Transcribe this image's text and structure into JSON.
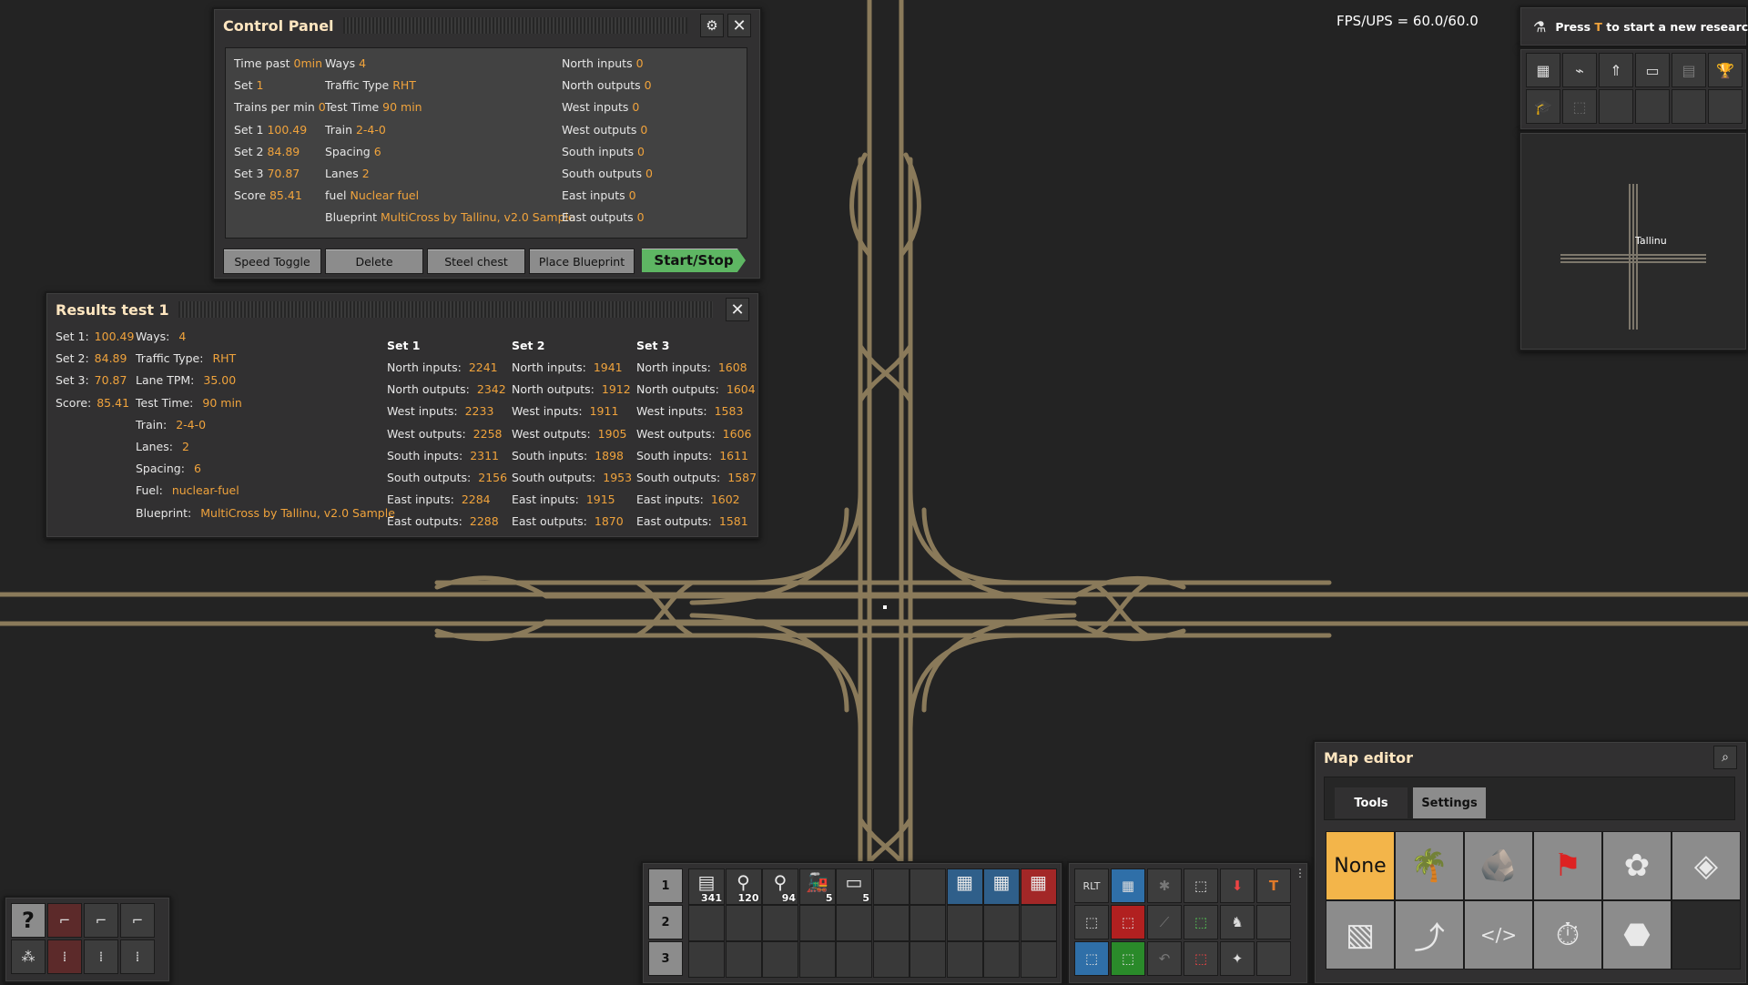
{
  "hud": {
    "fps": "FPS/UPS = 60.0/60.0"
  },
  "research": {
    "prefix": "Press ",
    "key": "T",
    "suffix": " to start a new research."
  },
  "minimap": {
    "label": "Tallinu"
  },
  "control_panel": {
    "title": "Control Panel",
    "col1": [
      {
        "label": "Time past ",
        "value": "0min"
      },
      {
        "label": "Set ",
        "value": "1"
      },
      {
        "label": "Trains per min ",
        "value": "0"
      },
      {
        "label": "Set 1 ",
        "value": "100.49"
      },
      {
        "label": "Set 2 ",
        "value": "84.89"
      },
      {
        "label": "Set 3 ",
        "value": "70.87"
      },
      {
        "label": "Score ",
        "value": "85.41"
      }
    ],
    "col2": [
      {
        "label": "Ways ",
        "value": "4"
      },
      {
        "label": "Traffic Type ",
        "value": "RHT"
      },
      {
        "label": "Test Time ",
        "value": "90 min"
      },
      {
        "label": "Train ",
        "value": "2-4-0"
      },
      {
        "label": "Spacing ",
        "value": "6"
      },
      {
        "label": "Lanes ",
        "value": "2"
      },
      {
        "label": "fuel ",
        "value": "Nuclear fuel"
      },
      {
        "label": "Blueprint ",
        "value": "MultiCross by Tallinu, v2.0 Sample"
      }
    ],
    "col3": [
      {
        "label": "North inputs ",
        "value": "0"
      },
      {
        "label": "North outputs ",
        "value": "0"
      },
      {
        "label": "West inputs ",
        "value": "0"
      },
      {
        "label": "West outputs ",
        "value": "0"
      },
      {
        "label": "South inputs ",
        "value": "0"
      },
      {
        "label": "South outputs ",
        "value": "0"
      },
      {
        "label": "East inputs ",
        "value": "0"
      },
      {
        "label": "East outputs ",
        "value": "0"
      }
    ],
    "buttons": {
      "speed_toggle": "Speed Toggle",
      "delete": "Delete",
      "steel_chest": "Steel chest",
      "place_blueprint": "Place Blueprint",
      "start_stop": "Start/Stop"
    }
  },
  "results": {
    "title": "Results test 1",
    "col1": [
      {
        "label": "Set 1:",
        "value": "100.49"
      },
      {
        "label": "Set 2:",
        "value": "84.89"
      },
      {
        "label": "Set 3:",
        "value": "70.87"
      },
      {
        "label": "Score:",
        "value": "85.41"
      }
    ],
    "col2": [
      {
        "label": "Ways:",
        "value": "4"
      },
      {
        "label": "Traffic Type:",
        "value": "RHT"
      },
      {
        "label": "Lane TPM:",
        "value": "35.00"
      },
      {
        "label": "Test Time:",
        "value": "90 min"
      },
      {
        "label": "Train:",
        "value": "2-4-0"
      },
      {
        "label": "Lanes:",
        "value": "2"
      },
      {
        "label": "Spacing:",
        "value": "6"
      },
      {
        "label": "Fuel:",
        "value": "nuclear-fuel"
      },
      {
        "label": "Blueprint:",
        "value": "MultiCross by Tallinu, v2.0 Sample"
      }
    ],
    "sets": [
      {
        "header": "Set 1",
        "rows": [
          {
            "label": "North inputs:",
            "value": "2241"
          },
          {
            "label": "North outputs:",
            "value": "2342"
          },
          {
            "label": "West inputs:",
            "value": "2233"
          },
          {
            "label": "West outputs:",
            "value": "2258"
          },
          {
            "label": "South inputs:",
            "value": "2311"
          },
          {
            "label": "South outputs:",
            "value": "2156"
          },
          {
            "label": "East inputs:",
            "value": "2284"
          },
          {
            "label": "East outputs:",
            "value": "2288"
          }
        ]
      },
      {
        "header": "Set 2",
        "rows": [
          {
            "label": "North inputs:",
            "value": "1941"
          },
          {
            "label": "North outputs:",
            "value": "1912"
          },
          {
            "label": "West inputs:",
            "value": "1911"
          },
          {
            "label": "West outputs:",
            "value": "1905"
          },
          {
            "label": "South inputs:",
            "value": "1898"
          },
          {
            "label": "South outputs:",
            "value": "1953"
          },
          {
            "label": "East inputs:",
            "value": "1915"
          },
          {
            "label": "East outputs:",
            "value": "1870"
          }
        ]
      },
      {
        "header": "Set 3",
        "rows": [
          {
            "label": "North inputs:",
            "value": "1608"
          },
          {
            "label": "North outputs:",
            "value": "1604"
          },
          {
            "label": "West inputs:",
            "value": "1583"
          },
          {
            "label": "West outputs:",
            "value": "1606"
          },
          {
            "label": "South inputs:",
            "value": "1611"
          },
          {
            "label": "South outputs:",
            "value": "1587"
          },
          {
            "label": "East inputs:",
            "value": "1602"
          },
          {
            "label": "East outputs:",
            "value": "1581"
          }
        ]
      }
    ]
  },
  "map_editor": {
    "title": "Map editor",
    "tabs": {
      "tools": "Tools",
      "settings": "Settings"
    },
    "none_label": "None",
    "tool_icons": [
      "tree-icon",
      "rock-icon",
      "flag-icon",
      "decoratives-icon",
      "tiles-icon",
      "ground-tiles-icon",
      "entity-placer-icon",
      "script-icon",
      "time-icon",
      "resource-icon"
    ]
  },
  "toolbar": {
    "rows": [
      "1",
      "2",
      "3"
    ],
    "quickbar": [
      {
        "icon": "rail-icon",
        "count": "341"
      },
      {
        "icon": "rail-signal-icon",
        "count": "120"
      },
      {
        "icon": "rail-chain-signal-icon",
        "count": "94"
      },
      {
        "icon": "locomotive-icon",
        "count": "5"
      },
      {
        "icon": "cargo-wagon-icon",
        "count": "5"
      },
      {
        "icon": "",
        "count": ""
      },
      {
        "icon": "",
        "count": ""
      },
      {
        "icon": "blueprint-icon",
        "count": ""
      },
      {
        "icon": "blueprint-icon",
        "count": ""
      },
      {
        "icon": "deconstruction-planner-icon",
        "count": ""
      }
    ]
  },
  "colors": {
    "accent_orange": "#f0a33c",
    "start_green": "#5eb663",
    "none_yellow": "#f3b54a",
    "panel": "#313031",
    "rail": "#8a7a5a"
  }
}
